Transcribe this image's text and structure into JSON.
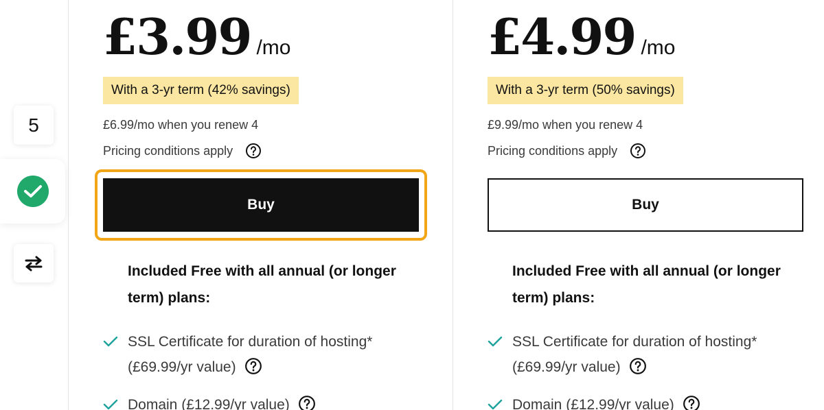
{
  "side_toolbar": {
    "step_number": "5",
    "status_icon": "check-circle-icon",
    "swap_icon": "swap-arrows-icon"
  },
  "plans": [
    {
      "price": "£3.99",
      "per": "/mo",
      "savings": "With a 3-yr term (42% savings)",
      "renew": "£6.99/mo when you renew 4",
      "pricing_conditions": "Pricing conditions apply",
      "buy_label": "Buy",
      "included_heading": "Included Free with all annual (or longer term) plans:",
      "features": [
        {
          "text": "SSL Certificate for duration of hosting* (£69.99/yr value)"
        },
        {
          "text": "Domain (£12.99/yr value)"
        }
      ]
    },
    {
      "price": "£4.99",
      "per": "/mo",
      "savings": "With a 3-yr term (50% savings)",
      "renew": "£9.99/mo when you renew 4",
      "pricing_conditions": "Pricing conditions apply",
      "buy_label": "Buy",
      "included_heading": "Included Free with all annual (or longer term) plans:",
      "features": [
        {
          "text": "SSL Certificate for duration of hosting* (£69.99/yr value)"
        },
        {
          "text": "Domain (£12.99/yr value)"
        }
      ]
    }
  ],
  "colors": {
    "savings_highlight": "#fbe6a2",
    "focus_ring": "#f2a516",
    "check_green": "#21a86b",
    "feature_tick": "#1ba39c"
  }
}
